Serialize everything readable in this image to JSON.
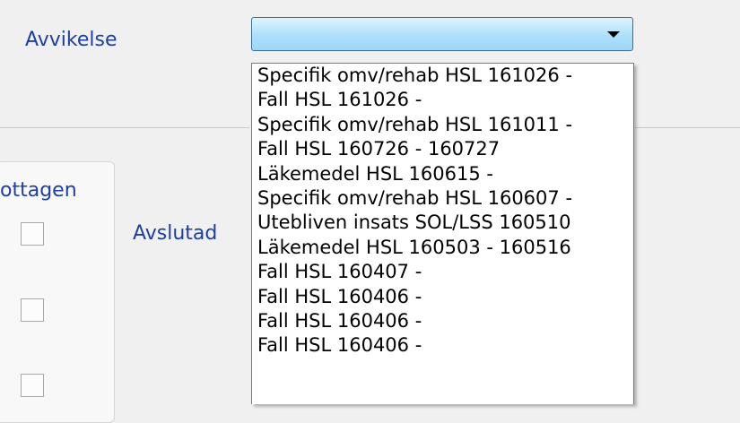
{
  "form": {
    "deviation_label": "Avvikelse",
    "received_label": "ottagen",
    "closed_label": "Avslutad"
  },
  "combobox": {
    "selected_value": ""
  },
  "dropdown": {
    "options": [
      "Specifik omv/rehab HSL 161026 -",
      "Fall HSL 161026 -",
      "Specifik omv/rehab HSL 161011 -",
      "Fall HSL 160726 - 160727",
      "Läkemedel HSL 160615 -",
      "Specifik omv/rehab HSL 160607 -",
      "Utebliven insats SOL/LSS 160510",
      "Läkemedel HSL 160503 - 160516",
      "Fall HSL 160407 -",
      "Fall HSL 160406 -",
      "Fall HSL 160406 -",
      "Fall HSL 160406 -"
    ]
  },
  "colors": {
    "label_blue": "#1f3f9e",
    "combo_blue": "#aee0fb"
  },
  "icons": [
    "dropdown-arrow-icon"
  ]
}
